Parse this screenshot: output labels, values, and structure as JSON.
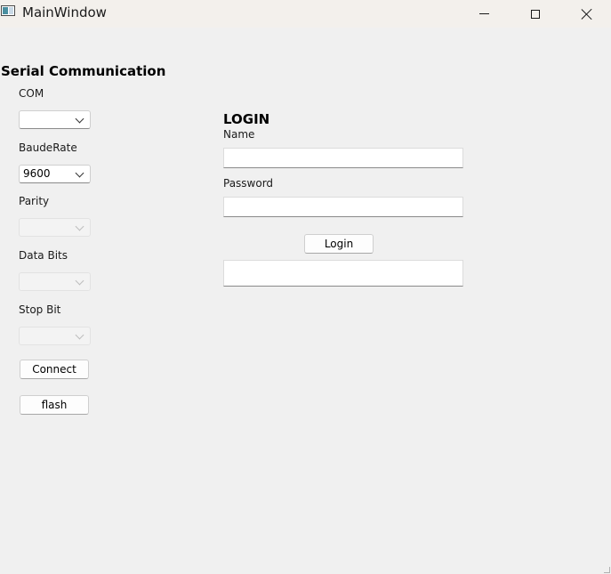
{
  "window": {
    "title": "MainWindow"
  },
  "serial": {
    "heading": "Serial Communication",
    "com_label": "COM",
    "com_value": "",
    "baud_label": "BaudeRate",
    "baud_value": "9600",
    "parity_label": "Parity",
    "parity_value": "",
    "databits_label": "Data Bits",
    "databits_value": "",
    "stopbit_label": "Stop Bit",
    "stopbit_value": "",
    "connect_label": "Connect",
    "flash_label": "flash"
  },
  "login": {
    "heading": "LOGIN",
    "name_label": "Name",
    "name_value": "",
    "password_label": "Password",
    "password_value": "",
    "login_button": "Login",
    "output_text": ""
  }
}
